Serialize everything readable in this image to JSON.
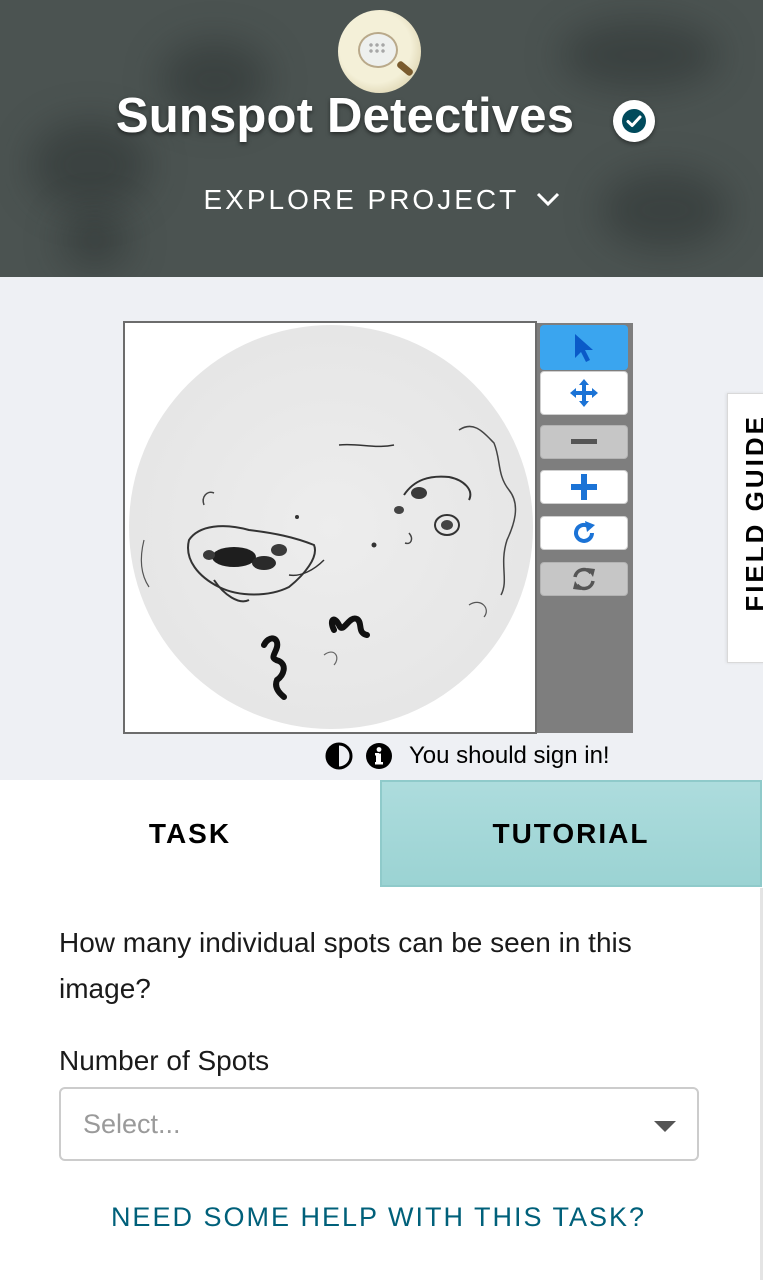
{
  "header": {
    "title": "Sunspot Detectives",
    "explore_label": "EXPLORE PROJECT",
    "avatar_icon": "magnifier-over-sun-avatar",
    "verified_icon": "verified-check-icon"
  },
  "viewer": {
    "field_guide_label": "FIELD GUIDE",
    "sign_in_text": "You should sign in!",
    "toolbar": [
      {
        "name": "pointer-icon",
        "active": true
      },
      {
        "name": "move-icon",
        "active": false
      },
      {
        "name": "zoom-out-icon",
        "active": false
      },
      {
        "name": "zoom-in-icon",
        "active": false
      },
      {
        "name": "rotate-icon",
        "active": false
      },
      {
        "name": "reset-icon",
        "active": false
      }
    ]
  },
  "tabs": {
    "task": "TASK",
    "tutorial": "TUTORIAL"
  },
  "task": {
    "question": "How many individual spots can be seen in this image?",
    "field_label": "Number of Spots",
    "select_placeholder": "Select...",
    "help_link": "NEED SOME HELP WITH THIS TASK?"
  },
  "colors": {
    "header_bg": "#4b5351",
    "accent_blue": "#3aa5ef",
    "tutorial_tab": "#a5d8d9",
    "help_link": "#00607a"
  }
}
